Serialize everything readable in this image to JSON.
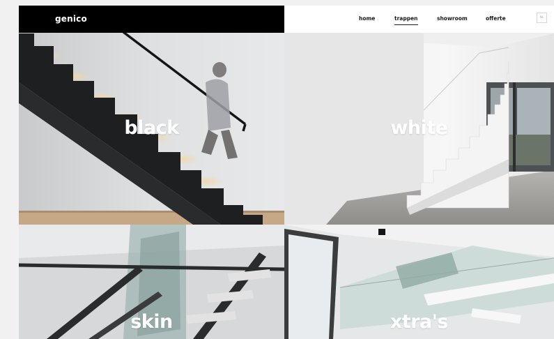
{
  "brand": {
    "logo": "genico"
  },
  "nav": {
    "items": [
      {
        "label": "home",
        "active": false
      },
      {
        "label": "trappen",
        "active": true
      },
      {
        "label": "showroom",
        "active": false
      },
      {
        "label": "offerte",
        "active": false
      }
    ],
    "language": "NL"
  },
  "tiles": [
    {
      "label": "black"
    },
    {
      "label": "white"
    },
    {
      "label": "skin"
    },
    {
      "label": "xtra's"
    }
  ],
  "colors": {
    "header_dark": "#000000",
    "accent_text": "#ffffff",
    "stair_black": "#1e1f21",
    "stair_white": "#f4f4f4",
    "floor_wood": "#c6a887"
  }
}
